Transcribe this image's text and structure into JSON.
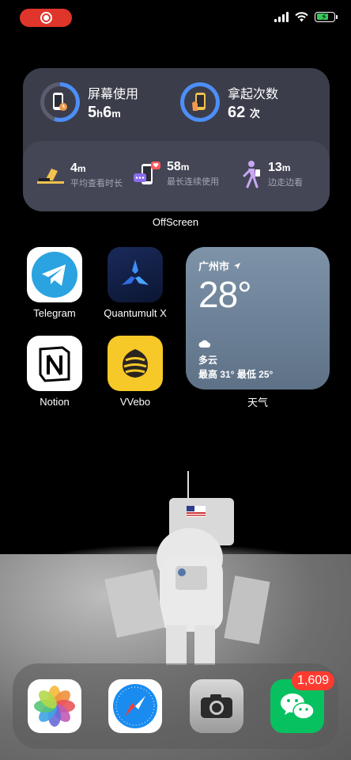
{
  "status_bar": {
    "recording_icon": "screen-recording-icon",
    "signal_icon": "cellular-signal-icon",
    "wifi_icon": "wifi-icon",
    "battery_icon": "battery-charging-icon"
  },
  "offscreen_widget": {
    "screen_time_label": "屏幕使用",
    "screen_time_hours": "5",
    "screen_time_h_unit": "h",
    "screen_time_minutes": "6",
    "screen_time_m_unit": "m",
    "pickups_label": "拿起次数",
    "pickups_value": "62",
    "pickups_unit": "次",
    "avg_view_value": "4",
    "avg_view_unit": "m",
    "avg_view_label": "平均查看时长",
    "longest_session_value": "58",
    "longest_session_unit": "m",
    "longest_session_label": "最长连续使用",
    "walking_value": "13",
    "walking_unit": "m",
    "walking_label": "边走边看",
    "caption": "OffScreen"
  },
  "apps": {
    "telegram": "Telegram",
    "quantumult": "Quantumult X",
    "notion": "Notion",
    "vvebo": "VVebo"
  },
  "weather_widget": {
    "city": "广州市",
    "temperature": "28°",
    "condition": "多云",
    "range": "最高 31° 最低 25°",
    "caption": "天气"
  },
  "dock": {
    "wechat_badge": "1,609",
    "apps": [
      "photos-app-icon",
      "safari-app-icon",
      "camera-app-icon",
      "wechat-app-icon"
    ]
  },
  "colors": {
    "record_pill": "#e0352b",
    "widget_bg": "#3b3d4a",
    "ring_blue": "#4d8ef7",
    "badge_red": "#ff3b30",
    "telegram_blue": "#2aa3e0",
    "vvebo_yellow": "#f7c928",
    "wechat_green": "#07c160"
  }
}
